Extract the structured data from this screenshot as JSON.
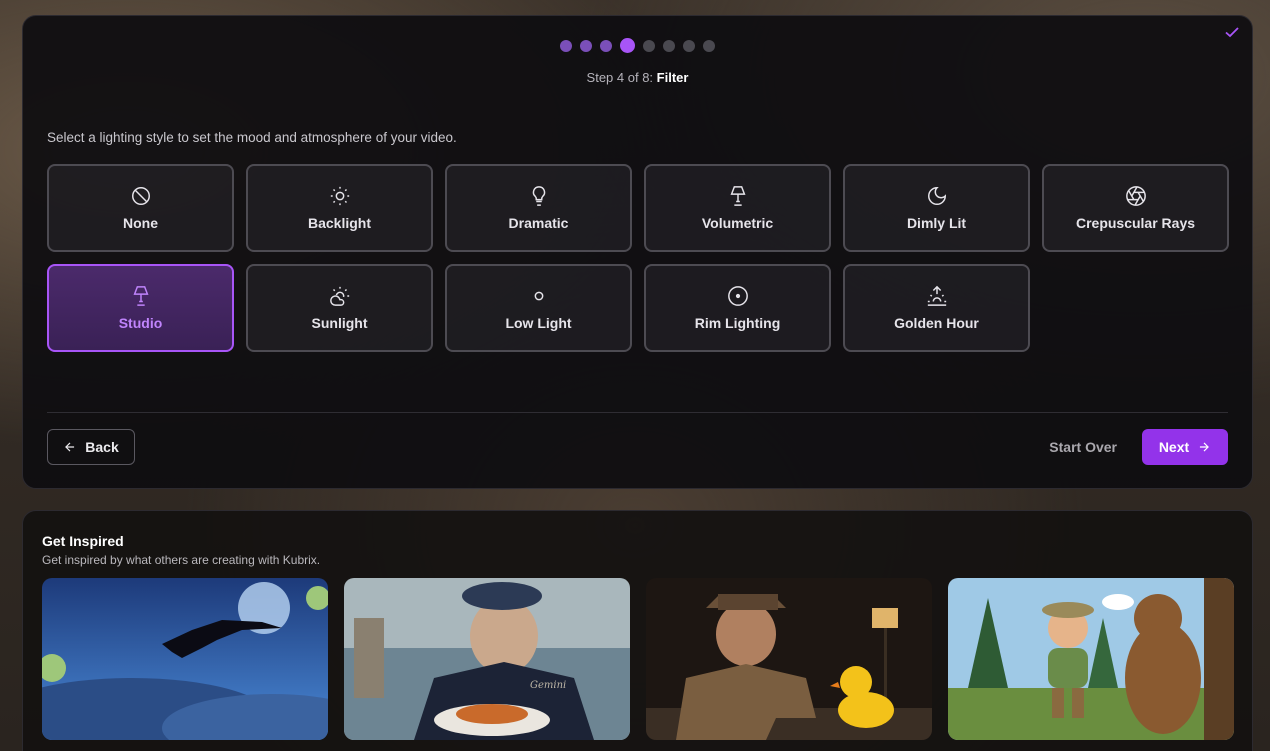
{
  "wizard": {
    "step_prefix": "Step 4 of 8: ",
    "step_name": "Filter",
    "total_steps": 8,
    "current_step": 4,
    "prompt": "Select a lighting style to set the mood and atmosphere of your video.",
    "options": [
      {
        "label": "None",
        "icon": "ban-icon"
      },
      {
        "label": "Backlight",
        "icon": "sun-icon"
      },
      {
        "label": "Dramatic",
        "icon": "lightbulb-icon"
      },
      {
        "label": "Volumetric",
        "icon": "lamp-icon"
      },
      {
        "label": "Dimly Lit",
        "icon": "moon-icon"
      },
      {
        "label": "Crepuscular Rays",
        "icon": "aperture-icon"
      },
      {
        "label": "Studio",
        "icon": "lamp-icon",
        "selected": true
      },
      {
        "label": "Sunlight",
        "icon": "sun-cloud-icon"
      },
      {
        "label": "Low Light",
        "icon": "sun-small-icon"
      },
      {
        "label": "Rim Lighting",
        "icon": "circle-dot-icon"
      },
      {
        "label": "Golden Hour",
        "icon": "sunrise-icon"
      }
    ],
    "back_label": "Back",
    "start_over_label": "Start Over",
    "next_label": "Next",
    "accent": "#9333ea"
  },
  "inspire": {
    "title": "Get Inspired",
    "subtitle": "Get inspired by what others are creating with Kubrix.",
    "thumbnails": [
      {
        "icon": "bird-night-thumbnail"
      },
      {
        "icon": "sailor-pasta-thumbnail",
        "caption": "Gemini"
      },
      {
        "icon": "detective-duck-thumbnail"
      },
      {
        "icon": "ranger-bear-thumbnail"
      }
    ]
  }
}
